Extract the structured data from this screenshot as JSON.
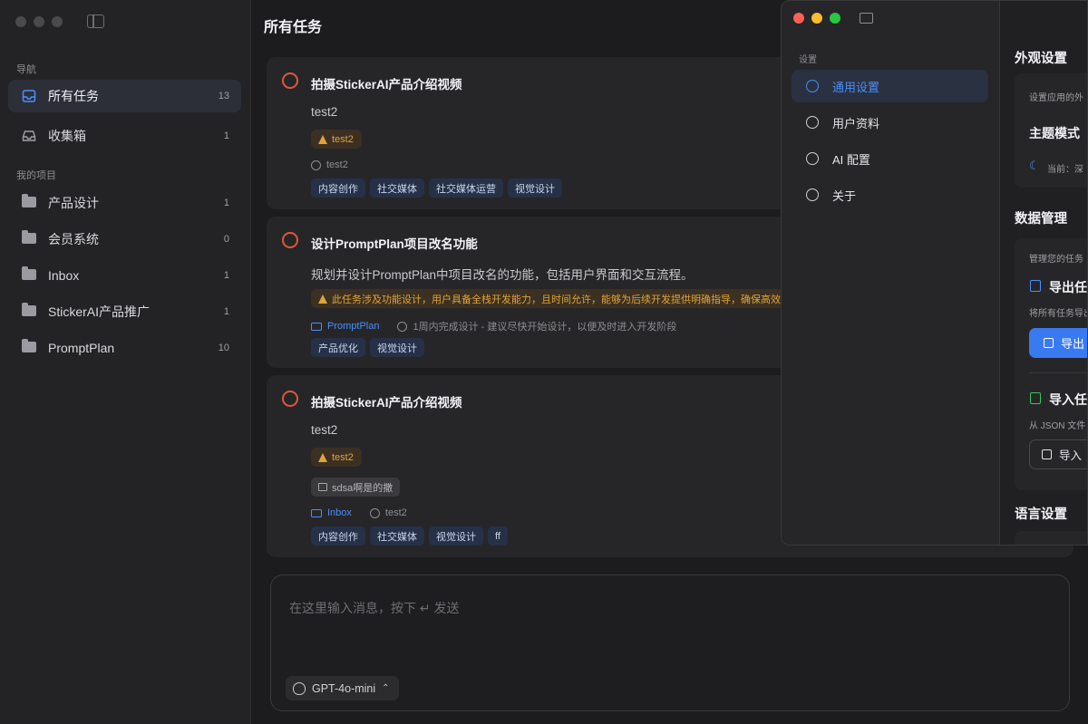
{
  "sidebar": {
    "nav_label": "导航",
    "nav_items": [
      {
        "label": "所有任务",
        "count": "13"
      },
      {
        "label": "收集箱",
        "count": "1"
      }
    ],
    "projects_label": "我的项目",
    "projects": [
      {
        "label": "产品设计",
        "count": "1"
      },
      {
        "label": "会员系统",
        "count": "0"
      },
      {
        "label": "Inbox",
        "count": "1"
      },
      {
        "label": "StickerAI产品推广",
        "count": "1"
      },
      {
        "label": "PromptPlan",
        "count": "10"
      }
    ]
  },
  "main": {
    "title": "所有任务",
    "tasks": [
      {
        "title": "拍摄StickerAI产品介绍视频",
        "description": "test2",
        "warning": "test2",
        "meta_time": "test2",
        "tags": [
          "内容创作",
          "社交媒体",
          "社交媒体运营",
          "视觉设计"
        ]
      },
      {
        "title": "设计PromptPlan项目改名功能",
        "description": "规划并设计PromptPlan中项目改名的功能，包括用户界面和交互流程。",
        "warning": "此任务涉及功能设计，用户具备全栈开发能力，且时间允许，能够为后续开发提供明确指导，确保高效执行。",
        "meta_project": "PromptPlan",
        "meta_time": "1周内完成设计 - 建议尽快开始设计，以便及时进入开发阶段",
        "tags": [
          "产品优化",
          "视觉设计"
        ]
      },
      {
        "title": "拍摄StickerAI产品介绍视频",
        "description": "test2",
        "warning": "test2",
        "note": "sdsa啊是的撒",
        "meta_project": "Inbox",
        "meta_time": "test2",
        "tags": [
          "内容创作",
          "社交媒体",
          "视觉设计",
          "ff"
        ]
      }
    ],
    "composer": {
      "placeholder": "在这里输入消息，按下 ↵ 发送",
      "model": "GPT-4o-mini"
    }
  },
  "settings": {
    "caption": "设置",
    "items": [
      "通用设置",
      "用户资料",
      "AI 配置",
      "关于"
    ],
    "appearance": {
      "heading": "外观设置",
      "sub": "设置应用的外",
      "theme_label": "主题模式",
      "current": "当前：深"
    },
    "data": {
      "heading": "数据管理",
      "sub": "管理您的任务",
      "export_label": "导出任",
      "export_desc": "将所有任务导出",
      "export_button": "导出",
      "import_label": "导入任",
      "import_desc": "从 JSON 文件",
      "import_button": "导入"
    },
    "language": {
      "heading": "语言设置"
    }
  },
  "colors": {
    "accent": "#4a8eff",
    "warning": "#e0a43a",
    "task_circle": "#e0573a",
    "primary_button": "#3a7af0"
  }
}
